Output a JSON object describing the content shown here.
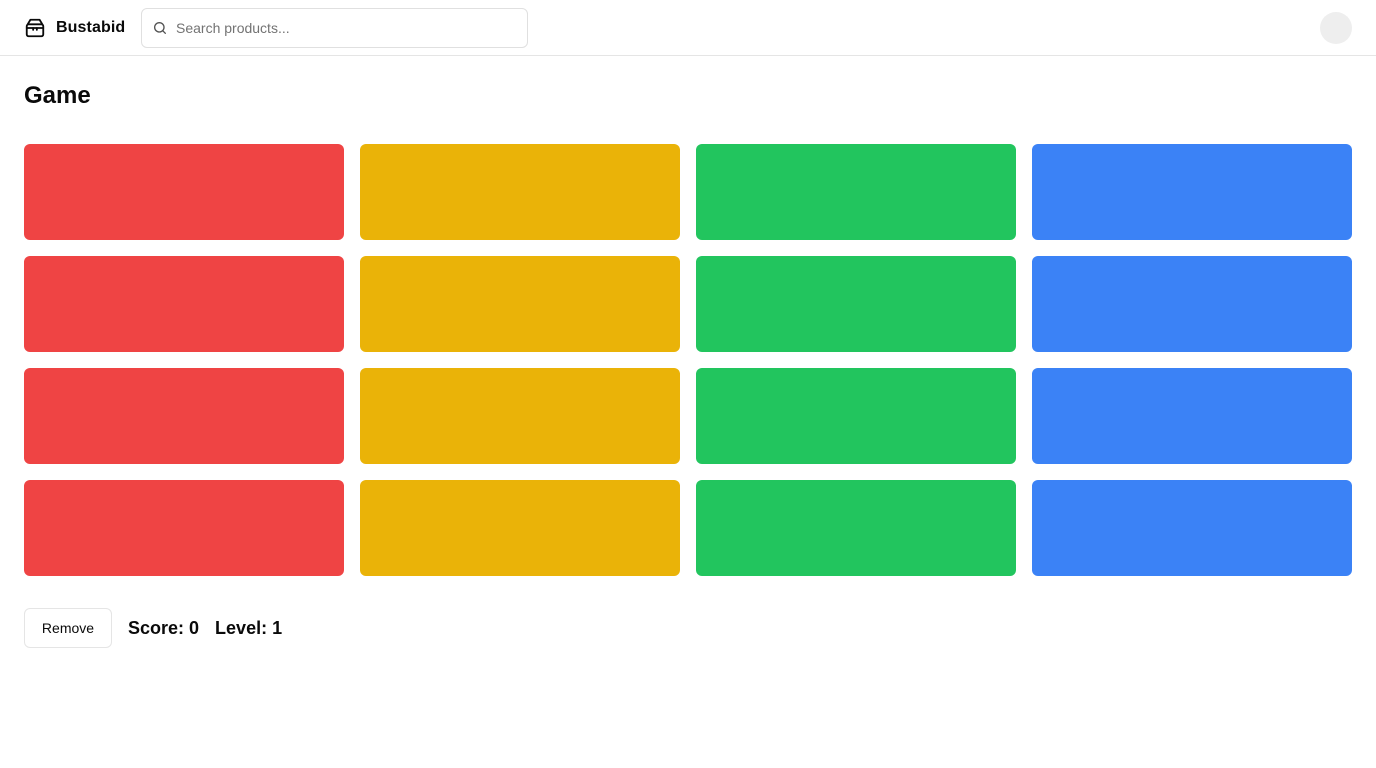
{
  "header": {
    "brand_name": "Bustabid",
    "brand_icon": "package-icon",
    "search": {
      "placeholder": "Search products...",
      "value": "",
      "icon": "search-icon"
    },
    "avatar": "user-avatar"
  },
  "main": {
    "title": "Game",
    "grid": {
      "rows": 4,
      "columns": 4,
      "column_colors": [
        "#ef4444",
        "#eab308",
        "#22c55e",
        "#3b82f6"
      ]
    },
    "controls": {
      "remove_label": "Remove",
      "score_text": "Score: 0",
      "level_text": "Level: 1"
    }
  }
}
